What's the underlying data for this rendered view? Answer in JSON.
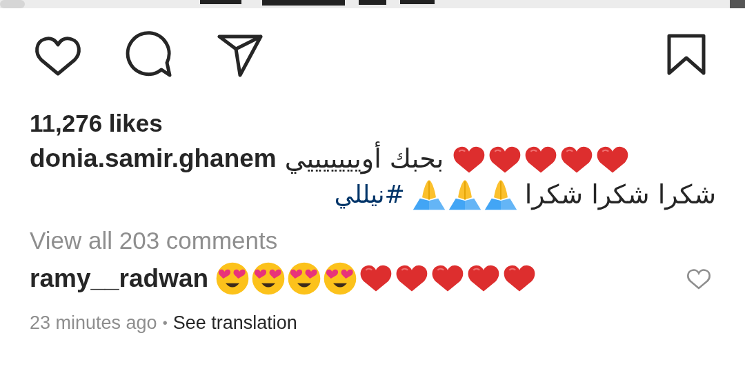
{
  "actions": {
    "liked": false,
    "saved": false
  },
  "likes": "11,276 likes",
  "caption": {
    "username": "donia.samir.ghanem",
    "text": "بحبك أويييييييي",
    "emojis": [
      {
        "kind": "red-heart"
      },
      {
        "kind": "red-heart"
      },
      {
        "kind": "red-heart"
      },
      {
        "kind": "red-heart"
      },
      {
        "kind": "red-heart"
      }
    ],
    "line_2": {
      "hashtag": "#نيللي",
      "emojis": [
        {
          "kind": "folded-hands"
        },
        {
          "kind": "folded-hands"
        },
        {
          "kind": "folded-hands"
        }
      ],
      "text": "شكرا شكرا شكرا"
    }
  },
  "view_comments": "View all 203 comments",
  "comments": [
    {
      "username": "ramy__radwan",
      "liked": false,
      "emojis": [
        {
          "kind": "heart-eyes"
        },
        {
          "kind": "heart-eyes"
        },
        {
          "kind": "heart-eyes"
        },
        {
          "kind": "heart-eyes"
        },
        {
          "kind": "red-heart"
        },
        {
          "kind": "red-heart"
        },
        {
          "kind": "red-heart"
        },
        {
          "kind": "red-heart"
        },
        {
          "kind": "red-heart"
        }
      ],
      "time": "23 minutes ago",
      "separator": "•",
      "action": "See translation"
    }
  ]
}
